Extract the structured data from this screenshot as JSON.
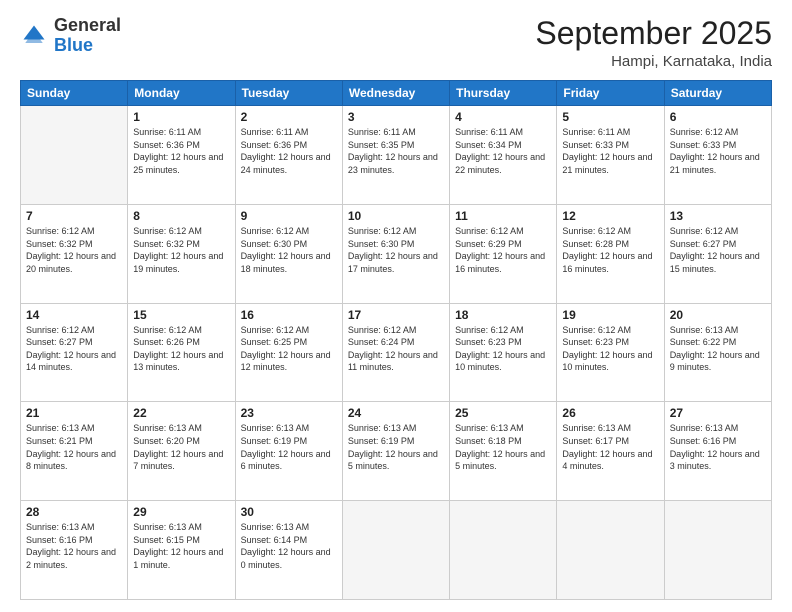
{
  "header": {
    "logo_general": "General",
    "logo_blue": "Blue",
    "month_title": "September 2025",
    "location": "Hampi, Karnataka, India"
  },
  "weekdays": [
    "Sunday",
    "Monday",
    "Tuesday",
    "Wednesday",
    "Thursday",
    "Friday",
    "Saturday"
  ],
  "weeks": [
    [
      {
        "day": "",
        "sunrise": "",
        "sunset": "",
        "daylight": ""
      },
      {
        "day": "1",
        "sunrise": "Sunrise: 6:11 AM",
        "sunset": "Sunset: 6:36 PM",
        "daylight": "Daylight: 12 hours and 25 minutes."
      },
      {
        "day": "2",
        "sunrise": "Sunrise: 6:11 AM",
        "sunset": "Sunset: 6:36 PM",
        "daylight": "Daylight: 12 hours and 24 minutes."
      },
      {
        "day": "3",
        "sunrise": "Sunrise: 6:11 AM",
        "sunset": "Sunset: 6:35 PM",
        "daylight": "Daylight: 12 hours and 23 minutes."
      },
      {
        "day": "4",
        "sunrise": "Sunrise: 6:11 AM",
        "sunset": "Sunset: 6:34 PM",
        "daylight": "Daylight: 12 hours and 22 minutes."
      },
      {
        "day": "5",
        "sunrise": "Sunrise: 6:11 AM",
        "sunset": "Sunset: 6:33 PM",
        "daylight": "Daylight: 12 hours and 21 minutes."
      },
      {
        "day": "6",
        "sunrise": "Sunrise: 6:12 AM",
        "sunset": "Sunset: 6:33 PM",
        "daylight": "Daylight: 12 hours and 21 minutes."
      }
    ],
    [
      {
        "day": "7",
        "sunrise": "Sunrise: 6:12 AM",
        "sunset": "Sunset: 6:32 PM",
        "daylight": "Daylight: 12 hours and 20 minutes."
      },
      {
        "day": "8",
        "sunrise": "Sunrise: 6:12 AM",
        "sunset": "Sunset: 6:32 PM",
        "daylight": "Daylight: 12 hours and 19 minutes."
      },
      {
        "day": "9",
        "sunrise": "Sunrise: 6:12 AM",
        "sunset": "Sunset: 6:30 PM",
        "daylight": "Daylight: 12 hours and 18 minutes."
      },
      {
        "day": "10",
        "sunrise": "Sunrise: 6:12 AM",
        "sunset": "Sunset: 6:30 PM",
        "daylight": "Daylight: 12 hours and 17 minutes."
      },
      {
        "day": "11",
        "sunrise": "Sunrise: 6:12 AM",
        "sunset": "Sunset: 6:29 PM",
        "daylight": "Daylight: 12 hours and 16 minutes."
      },
      {
        "day": "12",
        "sunrise": "Sunrise: 6:12 AM",
        "sunset": "Sunset: 6:28 PM",
        "daylight": "Daylight: 12 hours and 16 minutes."
      },
      {
        "day": "13",
        "sunrise": "Sunrise: 6:12 AM",
        "sunset": "Sunset: 6:27 PM",
        "daylight": "Daylight: 12 hours and 15 minutes."
      }
    ],
    [
      {
        "day": "14",
        "sunrise": "Sunrise: 6:12 AM",
        "sunset": "Sunset: 6:27 PM",
        "daylight": "Daylight: 12 hours and 14 minutes."
      },
      {
        "day": "15",
        "sunrise": "Sunrise: 6:12 AM",
        "sunset": "Sunset: 6:26 PM",
        "daylight": "Daylight: 12 hours and 13 minutes."
      },
      {
        "day": "16",
        "sunrise": "Sunrise: 6:12 AM",
        "sunset": "Sunset: 6:25 PM",
        "daylight": "Daylight: 12 hours and 12 minutes."
      },
      {
        "day": "17",
        "sunrise": "Sunrise: 6:12 AM",
        "sunset": "Sunset: 6:24 PM",
        "daylight": "Daylight: 12 hours and 11 minutes."
      },
      {
        "day": "18",
        "sunrise": "Sunrise: 6:12 AM",
        "sunset": "Sunset: 6:23 PM",
        "daylight": "Daylight: 12 hours and 10 minutes."
      },
      {
        "day": "19",
        "sunrise": "Sunrise: 6:12 AM",
        "sunset": "Sunset: 6:23 PM",
        "daylight": "Daylight: 12 hours and 10 minutes."
      },
      {
        "day": "20",
        "sunrise": "Sunrise: 6:13 AM",
        "sunset": "Sunset: 6:22 PM",
        "daylight": "Daylight: 12 hours and 9 minutes."
      }
    ],
    [
      {
        "day": "21",
        "sunrise": "Sunrise: 6:13 AM",
        "sunset": "Sunset: 6:21 PM",
        "daylight": "Daylight: 12 hours and 8 minutes."
      },
      {
        "day": "22",
        "sunrise": "Sunrise: 6:13 AM",
        "sunset": "Sunset: 6:20 PM",
        "daylight": "Daylight: 12 hours and 7 minutes."
      },
      {
        "day": "23",
        "sunrise": "Sunrise: 6:13 AM",
        "sunset": "Sunset: 6:19 PM",
        "daylight": "Daylight: 12 hours and 6 minutes."
      },
      {
        "day": "24",
        "sunrise": "Sunrise: 6:13 AM",
        "sunset": "Sunset: 6:19 PM",
        "daylight": "Daylight: 12 hours and 5 minutes."
      },
      {
        "day": "25",
        "sunrise": "Sunrise: 6:13 AM",
        "sunset": "Sunset: 6:18 PM",
        "daylight": "Daylight: 12 hours and 5 minutes."
      },
      {
        "day": "26",
        "sunrise": "Sunrise: 6:13 AM",
        "sunset": "Sunset: 6:17 PM",
        "daylight": "Daylight: 12 hours and 4 minutes."
      },
      {
        "day": "27",
        "sunrise": "Sunrise: 6:13 AM",
        "sunset": "Sunset: 6:16 PM",
        "daylight": "Daylight: 12 hours and 3 minutes."
      }
    ],
    [
      {
        "day": "28",
        "sunrise": "Sunrise: 6:13 AM",
        "sunset": "Sunset: 6:16 PM",
        "daylight": "Daylight: 12 hours and 2 minutes."
      },
      {
        "day": "29",
        "sunrise": "Sunrise: 6:13 AM",
        "sunset": "Sunset: 6:15 PM",
        "daylight": "Daylight: 12 hours and 1 minute."
      },
      {
        "day": "30",
        "sunrise": "Sunrise: 6:13 AM",
        "sunset": "Sunset: 6:14 PM",
        "daylight": "Daylight: 12 hours and 0 minutes."
      },
      {
        "day": "",
        "sunrise": "",
        "sunset": "",
        "daylight": ""
      },
      {
        "day": "",
        "sunrise": "",
        "sunset": "",
        "daylight": ""
      },
      {
        "day": "",
        "sunrise": "",
        "sunset": "",
        "daylight": ""
      },
      {
        "day": "",
        "sunrise": "",
        "sunset": "",
        "daylight": ""
      }
    ]
  ]
}
